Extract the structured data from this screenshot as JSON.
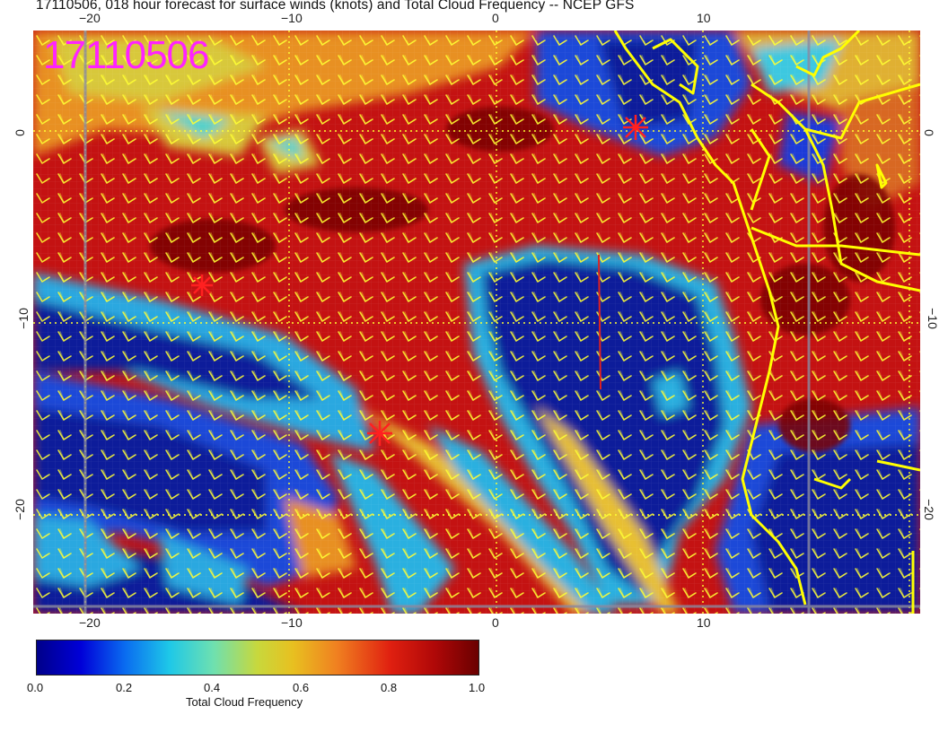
{
  "title": "17110506, 018 hour forecast for surface winds (knots) and Total Cloud Frequency -- NCEP GFS",
  "stamp": "17110506",
  "axes": {
    "top_ticks": [
      "−20",
      "−10",
      "0",
      "10"
    ],
    "bottom_ticks": [
      "−20",
      "−10",
      "0",
      "10"
    ],
    "left_ticks": [
      "0",
      "−10",
      "−20"
    ],
    "right_ticks": [
      "0",
      "−10",
      "−20"
    ]
  },
  "colorbar": {
    "title": "Total Cloud Frequency",
    "labels": [
      "0.0",
      "0.2",
      "0.4",
      "0.6",
      "0.8",
      "1.0"
    ]
  },
  "colors": {
    "wind_barbs": "#ffff33",
    "coastline": "#ffff00",
    "markers": "#ff2020",
    "stamp": "#ff22ff"
  },
  "markers": [
    {
      "name": "marker-north"
    },
    {
      "name": "marker-west"
    },
    {
      "name": "marker-south"
    }
  ]
}
